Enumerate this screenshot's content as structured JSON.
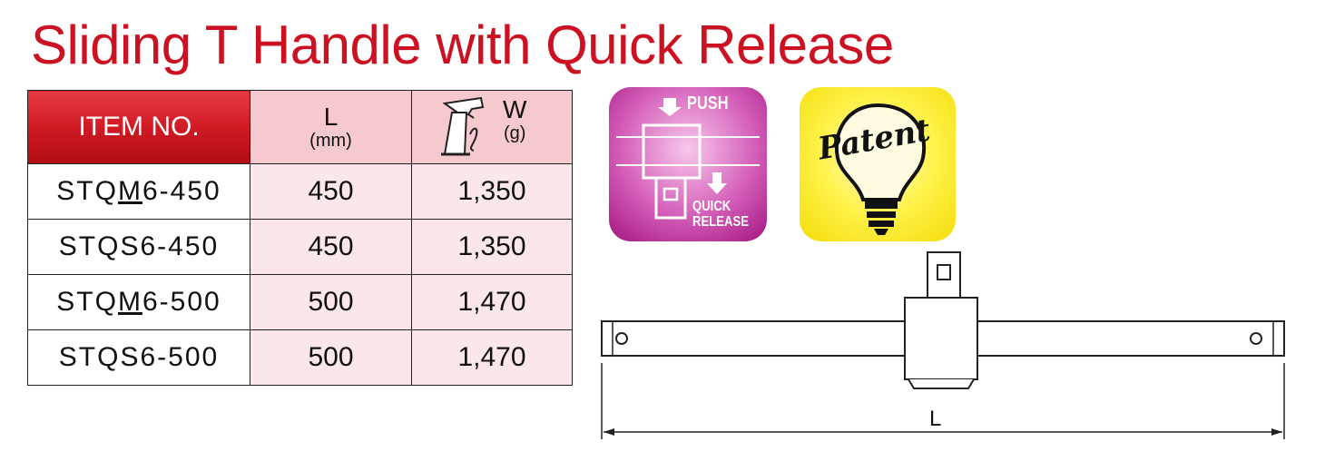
{
  "title": "Sliding T Handle with Quick Release",
  "table": {
    "headers": {
      "item": "ITEM NO.",
      "length_symbol": "L",
      "length_unit": "(mm)",
      "weight_symbol": "W",
      "weight_unit": "(g)"
    },
    "rows": [
      {
        "item_prefix": "STQ",
        "item_mark": "M",
        "item_suffix": "6-450",
        "length": "450",
        "weight": "1,350"
      },
      {
        "item_prefix": "STQ",
        "item_mark": "S",
        "item_suffix": "6-450",
        "length": "450",
        "weight": "1,350"
      },
      {
        "item_prefix": "STQ",
        "item_mark": "M",
        "item_suffix": "6-500",
        "length": "500",
        "weight": "1,470"
      },
      {
        "item_prefix": "STQ",
        "item_mark": "S",
        "item_suffix": "6-500",
        "length": "500",
        "weight": "1,470"
      }
    ]
  },
  "badges": {
    "quick_release": {
      "push": "PUSH",
      "quick": "QUICK",
      "release": "RELEASE",
      "icon": "push-quick-release-icon"
    },
    "patent": {
      "text": "Patent",
      "icon": "light-bulb-icon"
    }
  },
  "drawing": {
    "dimension_label": "L"
  },
  "colors": {
    "title": "#cc1122",
    "header_red": "#d01a24",
    "header_pink": "#f6c9cf",
    "cell_pink": "#fbe6ea",
    "badge_magenta": "#c23fa3",
    "badge_yellow": "#fff24a"
  }
}
